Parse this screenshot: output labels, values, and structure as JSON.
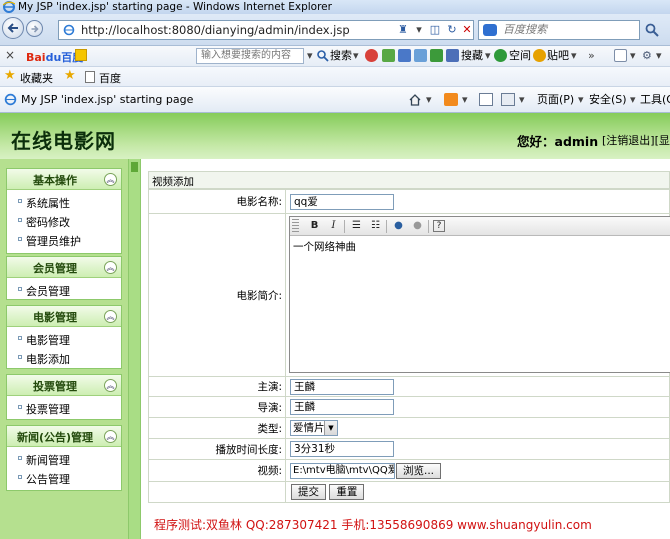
{
  "window": {
    "title": "My JSP 'index.jsp' starting page - Windows Internet Explorer"
  },
  "address_bar": {
    "url": "http://localhost:8080/dianying/admin/index.jsp",
    "search_placeholder": "百度搜索"
  },
  "baidu_toolbar": {
    "logo_part1": "Bai",
    "logo_part2": "du百度",
    "search_placeholder": "输入想要搜索的内容",
    "search_label": "搜索",
    "reader_label": "搜藏",
    "space_label": "空间",
    "tieba_label": "贴吧"
  },
  "favorites_bar": {
    "favorites_label": "收藏夹",
    "baidu_link": "百度"
  },
  "tab": {
    "title": "My JSP 'index.jsp' starting page"
  },
  "command_bar": {
    "page_menu": "页面(P)",
    "safety_menu": "安全(S)",
    "tools_menu": "工具(O)"
  },
  "header": {
    "site_title": "在线电影网",
    "greeting": "您好：",
    "username": "admin",
    "logout": "[注销退出]",
    "show": "[显示]"
  },
  "sidebar": {
    "groups": [
      {
        "title": "基本操作",
        "items": [
          "系统属性",
          "密码修改",
          "管理员维护"
        ]
      },
      {
        "title": "会员管理",
        "items": [
          "会员管理"
        ]
      },
      {
        "title": "电影管理",
        "items": [
          "电影管理",
          "电影添加"
        ]
      },
      {
        "title": "投票管理",
        "items": [
          "投票管理"
        ]
      },
      {
        "title": "新闻(公告)管理",
        "items": [
          "新闻管理",
          "公告管理"
        ]
      }
    ]
  },
  "form": {
    "panel_title": "视频添加",
    "fields": {
      "name_label": "电影名称:",
      "name_value": "qq爱",
      "intro_label": "电影简介:",
      "intro_value": "一个网络神曲",
      "actor_label": "主演:",
      "actor_value": "王麟",
      "director_label": "导演:",
      "director_value": "王麟",
      "type_label": "类型:",
      "type_value": "爱情片",
      "duration_label": "播放时间长度:",
      "duration_value": "3分31秒",
      "video_label": "视频:",
      "video_value": "E:\\mtv电脑\\mtv\\QQ爱.wr",
      "browse_label": "浏览..."
    },
    "submit_label": "提交",
    "reset_label": "重置"
  },
  "footer_note": "程序测试:双鱼林 QQ:287307421 手机:13558690869 www.shuangyulin.com"
}
